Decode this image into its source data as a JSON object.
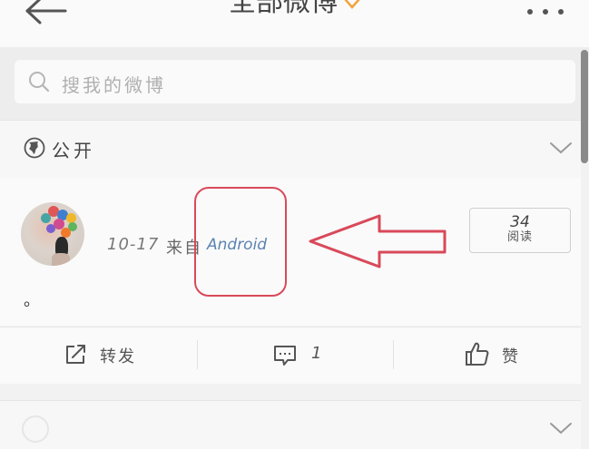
{
  "header": {
    "title": "全部微博",
    "back_icon": "back-arrow-icon",
    "caret_icon": "chevron-down-icon",
    "more_icon": "more-horizontal-icon",
    "accent_color": "#f2a33a"
  },
  "search": {
    "placeholder": "搜我的微博",
    "icon": "search-icon"
  },
  "visibility": {
    "label": "公开",
    "icon": "globe-icon"
  },
  "post": {
    "author_name": "",
    "time": "10-17",
    "source_prefix": "来自",
    "source_client": "Android",
    "content": "。",
    "read_count": "34",
    "read_label": "阅读"
  },
  "actions": {
    "repost_label": "转发",
    "comment_count": "1",
    "like_label": "赞"
  },
  "annotation": {
    "color": "#d9495a"
  }
}
